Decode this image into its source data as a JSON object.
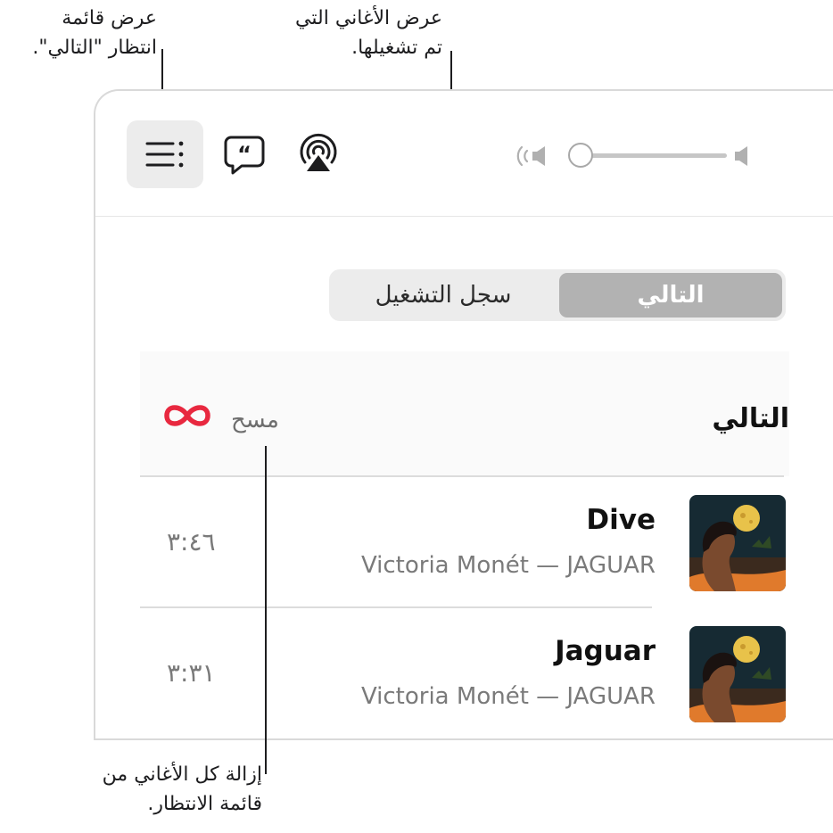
{
  "callouts": {
    "queue": [
      "عرض قائمة",
      "انتظار \"التالي\"."
    ],
    "history": [
      "عرض الأغاني التي",
      "تم تشغيلها."
    ],
    "clear": [
      "إزالة كل الأغاني من",
      "قائمة الانتظار."
    ]
  },
  "toolbar": {
    "queue_icon": "list-queue-icon",
    "lyrics_icon": "lyrics-quote-icon",
    "airplay_icon": "airplay-icon",
    "volume_low_icon": "speaker-low-icon",
    "volume_high_icon": "speaker-high-icon",
    "volume_level": 0
  },
  "segmented": {
    "history_label": "سجل التشغيل",
    "next_label": "التالي",
    "selected": "next"
  },
  "queue": {
    "title": "التالي",
    "clear_label": "مسح",
    "infinity_icon": "infinity-autoplay-icon",
    "accent_color": "#e8283f",
    "songs": [
      {
        "title": "Dive",
        "subtitle": "Victoria Monét — JAGUAR",
        "duration": "٣:٤٦"
      },
      {
        "title": "Jaguar",
        "subtitle": "Victoria Monét — JAGUAR",
        "duration": "٣:٣١"
      }
    ]
  }
}
